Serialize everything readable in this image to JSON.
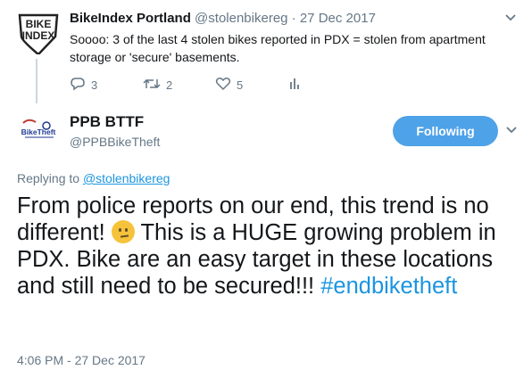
{
  "parent_tweet": {
    "avatar_text_line1": "BIKE",
    "avatar_text_line2": "INDEX",
    "display_name": "BikeIndex Portland",
    "handle": "@stolenbikereg",
    "separator": "·",
    "date": "27 Dec 2017",
    "text": "Soooo: 3 of the last 4 stolen bikes reported in PDX = stolen from apartment storage or 'secure' basements.",
    "reply_count": "3",
    "retweet_count": "2",
    "like_count": "5",
    "icons": [
      "reply-icon",
      "retweet-icon",
      "like-icon",
      "analytics-icon",
      "chevron-down-icon"
    ]
  },
  "main_tweet": {
    "avatar_text": "BikeTheft",
    "display_name": "PPB BTTF",
    "handle": "@PPBBikeTheft",
    "follow_label": "Following",
    "replying_prefix": "Replying to ",
    "replying_handle": "@stolenbikereg",
    "text_part1": "From police reports on our end, this trend is no different! ",
    "text_part2": " This is a HUGE growing problem in PDX. Bike are an easy target in these locations and still need to be secured!!! ",
    "hashtag": "#endbiketheft",
    "timestamp": "4:06 PM - 27 Dec 2017",
    "emoji": "confused-face",
    "colors": {
      "accent": "#1b95e0",
      "follow_bg": "#4ea2e8",
      "muted": "#657786"
    }
  }
}
